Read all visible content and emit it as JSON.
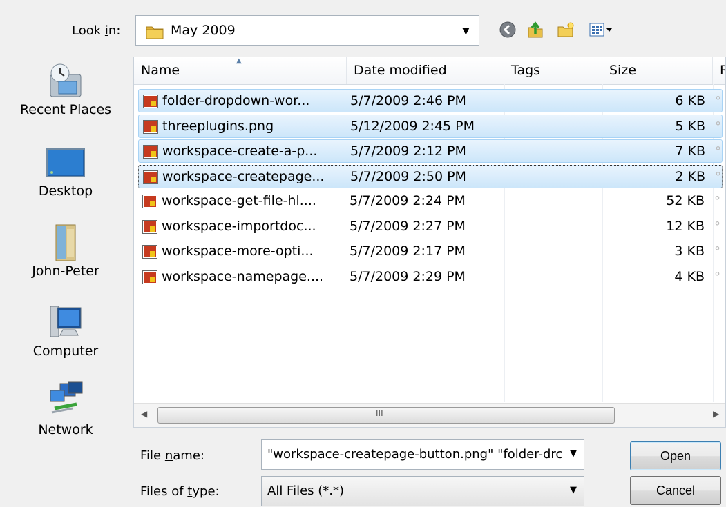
{
  "lookin": {
    "label_pre": "Look ",
    "label_key": "i",
    "label_post": "n:",
    "value": "May 2009"
  },
  "toolbar": {
    "back_icon": "back-icon",
    "up_icon": "up-folder-icon",
    "newfolder_icon": "new-folder-icon",
    "views_icon": "views-menu-icon"
  },
  "places": [
    {
      "label": "Recent Places",
      "icon": "recent-places-icon"
    },
    {
      "label": "Desktop",
      "icon": "desktop-icon"
    },
    {
      "label": "John-Peter",
      "icon": "user-folder-icon"
    },
    {
      "label": "Computer",
      "icon": "computer-icon"
    },
    {
      "label": "Network",
      "icon": "network-icon"
    }
  ],
  "columns": {
    "name": "Name",
    "date": "Date modified",
    "tags": "Tags",
    "size": "Size",
    "more": "R"
  },
  "files": [
    {
      "name": "folder-dropdown-wor...",
      "date": "5/7/2009 2:46 PM",
      "size": "6 KB"
    },
    {
      "name": "threeplugins.png",
      "date": "5/12/2009 2:45 PM",
      "size": "5 KB"
    },
    {
      "name": "workspace-create-a-p...",
      "date": "5/7/2009 2:12 PM",
      "size": "7 KB"
    },
    {
      "name": "workspace-createpage...",
      "date": "5/7/2009 2:50 PM",
      "size": "2 KB"
    },
    {
      "name": "workspace-get-file-hl....",
      "date": "5/7/2009 2:24 PM",
      "size": "52 KB"
    },
    {
      "name": "workspace-importdoc...",
      "date": "5/7/2009 2:27 PM",
      "size": "12 KB"
    },
    {
      "name": "workspace-more-opti...",
      "date": "5/7/2009 2:17 PM",
      "size": "3 KB"
    },
    {
      "name": "workspace-namepage....",
      "date": "5/7/2009 2:29 PM",
      "size": "4 KB"
    }
  ],
  "scroll_grip": "III",
  "filename": {
    "label_pre": "File ",
    "label_key": "n",
    "label_post": "ame:",
    "value": "\"workspace-createpage-button.png\" \"folder-drc"
  },
  "filetype": {
    "label_pre": "Files of ",
    "label_key": "t",
    "label_post": "ype:",
    "value": "All Files (*.*)"
  },
  "buttons": {
    "open": "Open",
    "cancel": "Cancel"
  }
}
